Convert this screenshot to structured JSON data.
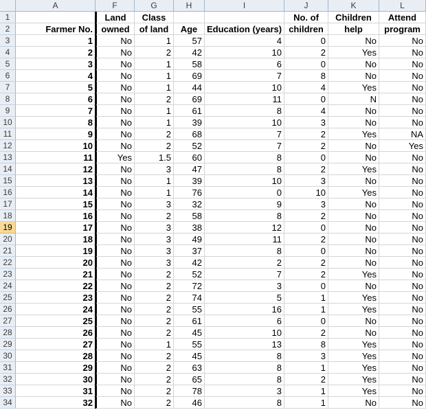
{
  "columns": [
    "A",
    "F",
    "G",
    "H",
    "I",
    "J",
    "K",
    "L"
  ],
  "header_row1": [
    "",
    "Land",
    "Class",
    "",
    "",
    "No. of",
    "Children",
    "Attend"
  ],
  "header_row2": [
    "Farmer No.",
    "owned",
    "of land",
    "Age",
    "Education (years)",
    "children",
    "help",
    "program"
  ],
  "selected_row": 19,
  "rows": [
    [
      1,
      "No",
      "1",
      "57",
      "4",
      "0",
      "No",
      "No"
    ],
    [
      2,
      "No",
      "2",
      "42",
      "10",
      "2",
      "Yes",
      "No"
    ],
    [
      3,
      "No",
      "1",
      "58",
      "6",
      "0",
      "No",
      "No"
    ],
    [
      4,
      "No",
      "1",
      "69",
      "7",
      "8",
      "No",
      "No"
    ],
    [
      5,
      "No",
      "1",
      "44",
      "10",
      "4",
      "Yes",
      "No"
    ],
    [
      6,
      "No",
      "2",
      "69",
      "11",
      "0",
      "N",
      "No"
    ],
    [
      7,
      "No",
      "1",
      "61",
      "8",
      "4",
      "No",
      "No"
    ],
    [
      8,
      "No",
      "1",
      "39",
      "10",
      "3",
      "No",
      "No"
    ],
    [
      9,
      "No",
      "2",
      "68",
      "7",
      "2",
      "Yes",
      "NA"
    ],
    [
      10,
      "No",
      "2",
      "52",
      "7",
      "2",
      "No",
      "Yes"
    ],
    [
      11,
      "Yes",
      "1.5",
      "60",
      "8",
      "0",
      "No",
      "No"
    ],
    [
      12,
      "No",
      "3",
      "47",
      "8",
      "2",
      "Yes",
      "No"
    ],
    [
      13,
      "No",
      "1",
      "39",
      "10",
      "3",
      "No",
      "No"
    ],
    [
      14,
      "No",
      "1",
      "76",
      "0",
      "10",
      "Yes",
      "No"
    ],
    [
      15,
      "No",
      "3",
      "32",
      "9",
      "3",
      "No",
      "No"
    ],
    [
      16,
      "No",
      "2",
      "58",
      "8",
      "2",
      "No",
      "No"
    ],
    [
      17,
      "No",
      "3",
      "38",
      "12",
      "0",
      "No",
      "No"
    ],
    [
      18,
      "No",
      "3",
      "49",
      "11",
      "2",
      "No",
      "No"
    ],
    [
      19,
      "No",
      "3",
      "37",
      "8",
      "0",
      "No",
      "No"
    ],
    [
      20,
      "No",
      "3",
      "42",
      "2",
      "2",
      "No",
      "No"
    ],
    [
      21,
      "No",
      "2",
      "52",
      "7",
      "2",
      "Yes",
      "No"
    ],
    [
      22,
      "No",
      "2",
      "72",
      "3",
      "0",
      "No",
      "No"
    ],
    [
      23,
      "No",
      "2",
      "74",
      "5",
      "1",
      "Yes",
      "No"
    ],
    [
      24,
      "No",
      "2",
      "55",
      "16",
      "1",
      "Yes",
      "No"
    ],
    [
      25,
      "No",
      "2",
      "61",
      "6",
      "0",
      "No",
      "No"
    ],
    [
      26,
      "No",
      "2",
      "45",
      "10",
      "2",
      "No",
      "No"
    ],
    [
      27,
      "No",
      "1",
      "55",
      "13",
      "8",
      "Yes",
      "No"
    ],
    [
      28,
      "No",
      "2",
      "45",
      "8",
      "3",
      "Yes",
      "No"
    ],
    [
      29,
      "No",
      "2",
      "63",
      "8",
      "1",
      "Yes",
      "No"
    ],
    [
      30,
      "No",
      "2",
      "65",
      "8",
      "2",
      "Yes",
      "No"
    ],
    [
      31,
      "No",
      "2",
      "78",
      "3",
      "1",
      "Yes",
      "No"
    ],
    [
      32,
      "No",
      "2",
      "46",
      "8",
      "1",
      "No",
      "No"
    ]
  ]
}
